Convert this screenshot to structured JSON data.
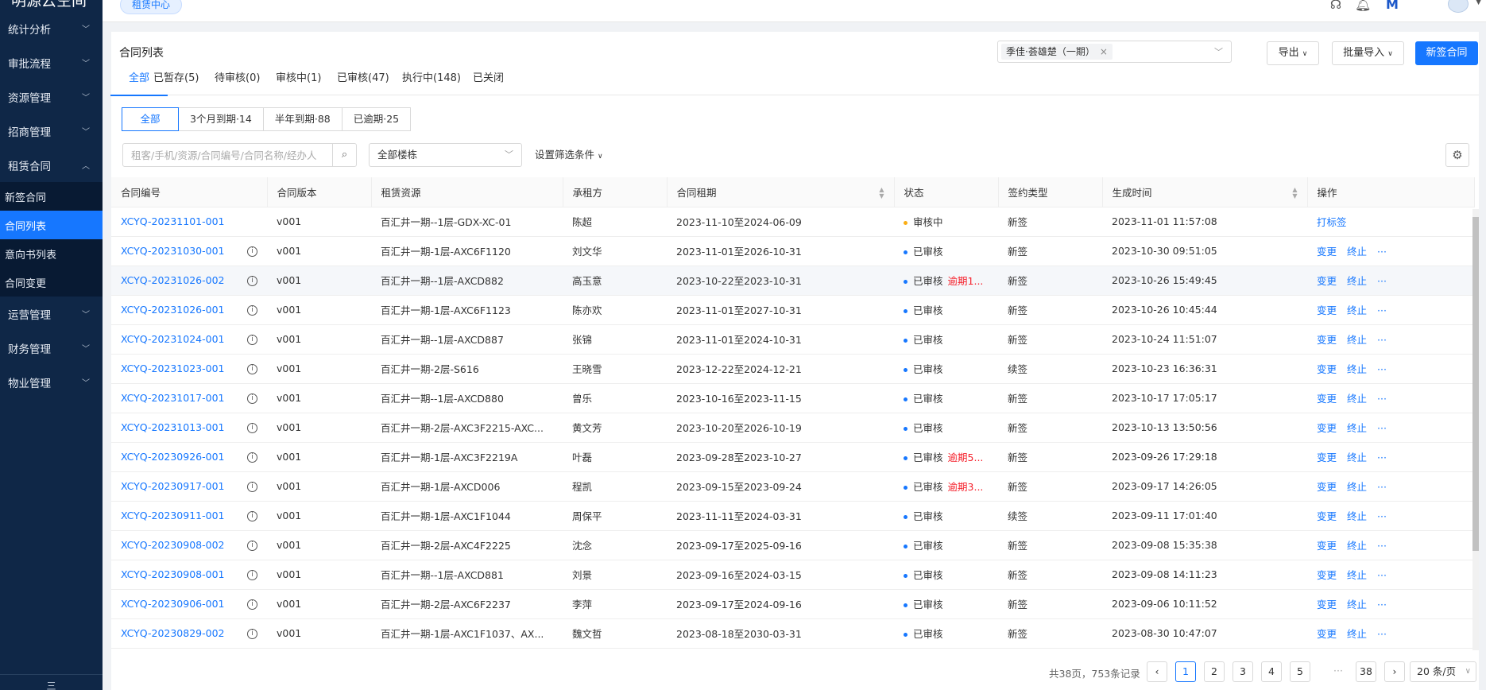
{
  "app": {
    "logo": "明源云空间"
  },
  "sidebar": {
    "groups_before": [
      {
        "label": "统计分析"
      },
      {
        "label": "审批流程"
      },
      {
        "label": "资源管理"
      },
      {
        "label": "招商管理"
      }
    ],
    "open_group": {
      "label": "租赁合同",
      "items": [
        {
          "label": "新签合同"
        },
        {
          "label": "合同列表"
        },
        {
          "label": "意向书列表"
        },
        {
          "label": "合同变更"
        }
      ]
    },
    "groups_after": [
      {
        "label": "运营管理"
      },
      {
        "label": "财务管理"
      },
      {
        "label": "物业管理"
      }
    ],
    "bottom": "三"
  },
  "topbar": {
    "tab": "租赁中心"
  },
  "page": {
    "title": "合同列表",
    "project": "季佳·荟雄楚（一期）",
    "export_label": "导出",
    "import_label": "批量导入",
    "new_label": "新签合同"
  },
  "status_tabs": [
    "全部",
    "已暂存(5)",
    "待审核(0)",
    "审核中(1)",
    "已审核(47)",
    "执行中(148)",
    "已关闭"
  ],
  "expiry_filters": [
    "全部",
    "3个月到期·14",
    "半年到期·88",
    "已逾期·25"
  ],
  "filters": {
    "search_placeholder": "租客/手机/资源/合同编号/合同名称/经办人",
    "building": "全部楼栋",
    "more": "设置筛选条件"
  },
  "table": {
    "columns": [
      "合同编号",
      "合同版本",
      "租赁资源",
      "承租方",
      "合同租期",
      "状态",
      "签约类型",
      "生成时间",
      "操作"
    ],
    "ops": {
      "change": "变更",
      "terminate": "终止",
      "more": "···",
      "tag": "打标签"
    },
    "rows": [
      {
        "code": "XCYQ-20231101-001",
        "version": "v001",
        "resource": "百汇井一期--1层-GDX-XC-01",
        "tenant": "陈超",
        "term": "2023-11-10至2024-06-09",
        "status": "审核中",
        "overdue": "",
        "sign": "新签",
        "created": "2023-11-01 11:57:08"
      },
      {
        "code": "XCYQ-20231030-001",
        "version": "v001",
        "resource": "百汇井一期-1层-AXC6F1120",
        "tenant": "刘文华",
        "term": "2023-11-01至2026-10-31",
        "status": "已审核",
        "overdue": "",
        "sign": "新签",
        "created": "2023-10-30 09:51:05"
      },
      {
        "code": "XCYQ-20231026-002",
        "version": "v001",
        "resource": "百汇井一期--1层-AXCD882",
        "tenant": "高玉意",
        "term": "2023-10-22至2023-10-31",
        "status": "已审核",
        "overdue": "逾期1...",
        "sign": "新签",
        "created": "2023-10-26 15:49:45"
      },
      {
        "code": "XCYQ-20231026-001",
        "version": "v001",
        "resource": "百汇井一期-1层-AXC6F1123",
        "tenant": "陈亦欢",
        "term": "2023-11-01至2027-10-31",
        "status": "已审核",
        "overdue": "",
        "sign": "新签",
        "created": "2023-10-26 10:45:44"
      },
      {
        "code": "XCYQ-20231024-001",
        "version": "v001",
        "resource": "百汇井一期--1层-AXCD887",
        "tenant": "张锦",
        "term": "2023-11-01至2024-10-31",
        "status": "已审核",
        "overdue": "",
        "sign": "新签",
        "created": "2023-10-24 11:51:07"
      },
      {
        "code": "XCYQ-20231023-001",
        "version": "v001",
        "resource": "百汇井一期-2层-S616",
        "tenant": "王晓雪",
        "term": "2023-12-22至2024-12-21",
        "status": "已审核",
        "overdue": "",
        "sign": "续签",
        "created": "2023-10-23 16:36:31"
      },
      {
        "code": "XCYQ-20231017-001",
        "version": "v001",
        "resource": "百汇井一期--1层-AXCD880",
        "tenant": "曾乐",
        "term": "2023-10-16至2023-11-15",
        "status": "已审核",
        "overdue": "",
        "sign": "新签",
        "created": "2023-10-17 17:05:17"
      },
      {
        "code": "XCYQ-20231013-001",
        "version": "v001",
        "resource": "百汇井一期-2层-AXC3F2215-AXC...",
        "tenant": "黄文芳",
        "term": "2023-10-20至2026-10-19",
        "status": "已审核",
        "overdue": "",
        "sign": "新签",
        "created": "2023-10-13 13:50:56"
      },
      {
        "code": "XCYQ-20230926-001",
        "version": "v001",
        "resource": "百汇井一期-1层-AXC3F2219A",
        "tenant": "叶磊",
        "term": "2023-09-28至2023-10-27",
        "status": "已审核",
        "overdue": "逾期5...",
        "sign": "新签",
        "created": "2023-09-26 17:29:18"
      },
      {
        "code": "XCYQ-20230917-001",
        "version": "v001",
        "resource": "百汇井一期-1层-AXCD006",
        "tenant": "程凯",
        "term": "2023-09-15至2023-09-24",
        "status": "已审核",
        "overdue": "逾期3...",
        "sign": "新签",
        "created": "2023-09-17 14:26:05"
      },
      {
        "code": "XCYQ-20230911-001",
        "version": "v001",
        "resource": "百汇井一期-1层-AXC1F1044",
        "tenant": "周保平",
        "term": "2023-11-11至2024-03-31",
        "status": "已审核",
        "overdue": "",
        "sign": "续签",
        "created": "2023-09-11 17:01:40"
      },
      {
        "code": "XCYQ-20230908-002",
        "version": "v001",
        "resource": "百汇井一期-2层-AXC4F2225",
        "tenant": "沈念",
        "term": "2023-09-17至2025-09-16",
        "status": "已审核",
        "overdue": "",
        "sign": "新签",
        "created": "2023-09-08 15:35:38"
      },
      {
        "code": "XCYQ-20230908-001",
        "version": "v001",
        "resource": "百汇井一期--1层-AXCD881",
        "tenant": "刘景",
        "term": "2023-09-16至2024-03-15",
        "status": "已审核",
        "overdue": "",
        "sign": "新签",
        "created": "2023-09-08 14:11:23"
      },
      {
        "code": "XCYQ-20230906-001",
        "version": "v001",
        "resource": "百汇井一期-2层-AXC6F2237",
        "tenant": "李萍",
        "term": "2023-09-17至2024-09-16",
        "status": "已审核",
        "overdue": "",
        "sign": "新签",
        "created": "2023-09-06 10:11:52"
      },
      {
        "code": "XCYQ-20230829-002",
        "version": "v001",
        "resource": "百汇井一期-1层-AXC1F1037、AX...",
        "tenant": "魏文哲",
        "term": "2023-08-18至2030-03-31",
        "status": "已审核",
        "overdue": "",
        "sign": "新签",
        "created": "2023-08-30 10:47:07"
      }
    ]
  },
  "pagination": {
    "total": "共38页，753条记录",
    "pages": [
      "1",
      "2",
      "3",
      "4",
      "5"
    ],
    "last": "38",
    "ellipsis": "···",
    "page_size": "20 条/页"
  }
}
